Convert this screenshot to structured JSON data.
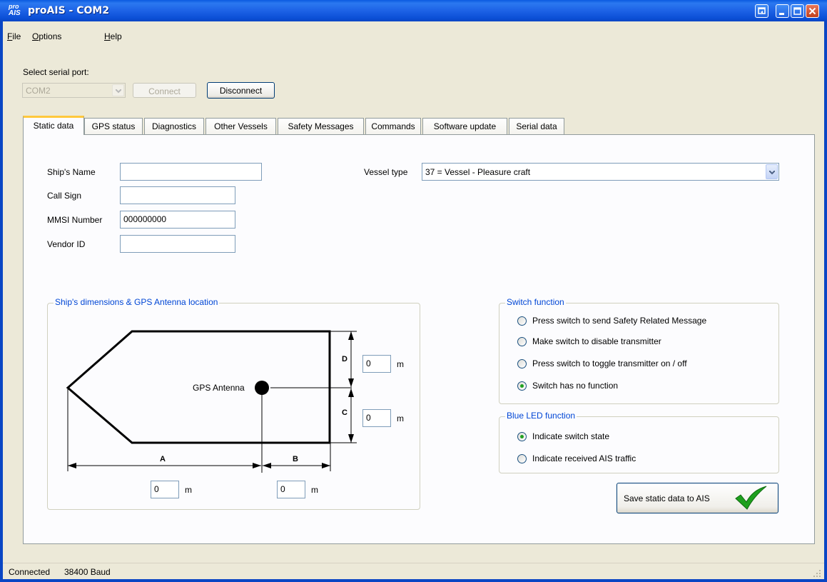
{
  "window": {
    "logo_top": "pro",
    "logo_bottom": "AIS",
    "title": "proAIS - COM2",
    "caption_buttons": [
      "restore-icon",
      "minimize-icon",
      "maximize-icon",
      "close-icon"
    ]
  },
  "menu": [
    {
      "label": "File",
      "accel": "F"
    },
    {
      "label": "Options",
      "accel": "O"
    },
    {
      "label": "Help",
      "accel": "H"
    }
  ],
  "connection": {
    "select_label": "Select serial port:",
    "port_value": "COM2",
    "connect_label": "Connect",
    "disconnect_label": "Disconnect"
  },
  "tabs": [
    {
      "label": "Static data",
      "active": true
    },
    {
      "label": "GPS status"
    },
    {
      "label": "Diagnostics"
    },
    {
      "label": "Other Vessels"
    },
    {
      "label": "Safety Messages"
    },
    {
      "label": "Commands"
    },
    {
      "label": "Software update"
    },
    {
      "label": "Serial data"
    }
  ],
  "static_data": {
    "ship_name_label": "Ship's Name",
    "ship_name_value": "",
    "call_sign_label": "Call Sign",
    "call_sign_value": "",
    "mmsi_label": "MMSI Number",
    "mmsi_value": "000000000",
    "vendor_label": "Vendor ID",
    "vendor_value": "",
    "vessel_type_label": "Vessel type",
    "vessel_type_value": "37 = Vessel - Pleasure craft"
  },
  "dimensions": {
    "group_title": "Ship's dimensions & GPS Antenna location",
    "antenna_label": "GPS Antenna",
    "label_a": "A",
    "label_b": "B",
    "label_c": "C",
    "label_d": "D",
    "value_a": "0",
    "value_b": "0",
    "value_c": "0",
    "value_d": "0",
    "unit": "m"
  },
  "switch_function": {
    "group_title": "Switch function",
    "options": [
      {
        "label": "Press switch to send Safety Related Message",
        "checked": false
      },
      {
        "label": "Make switch to disable transmitter",
        "checked": false
      },
      {
        "label": "Press switch to toggle transmitter on / off",
        "checked": false
      },
      {
        "label": "Switch has no function",
        "checked": true
      }
    ]
  },
  "led_function": {
    "group_title": "Blue LED function",
    "options": [
      {
        "label": "Indicate switch state",
        "checked": true
      },
      {
        "label": "Indicate received AIS traffic",
        "checked": false
      }
    ]
  },
  "save_button": {
    "label": "Save static data to AIS",
    "icon": "checkmark-icon"
  },
  "status": {
    "connection": "Connected",
    "baud": "38400 Baud"
  },
  "colors": {
    "titlebar": "#0A46C4",
    "group_title": "#0046D5",
    "checkmark": "#1EA01E",
    "active_tab_accent": "#FFC83C"
  }
}
